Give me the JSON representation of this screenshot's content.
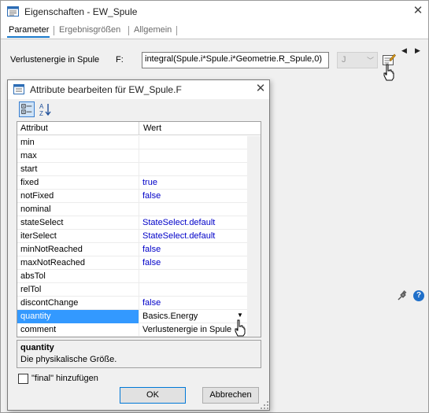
{
  "window": {
    "title": "Eigenschaften - EW_Spule",
    "tabs": [
      {
        "label": "Parameter",
        "active": true
      },
      {
        "label": "Ergebnisgrößen",
        "active": false
      },
      {
        "label": "Allgemein",
        "active": false
      }
    ],
    "param": {
      "label": "Verlustenergie in Spule",
      "name": "F:",
      "value": "integral(Spule.i*Spule.i*Geometrie.R_Spule,0)",
      "unit": "J"
    }
  },
  "dialog": {
    "title": "Attribute bearbeiten für EW_Spule.F",
    "columns": [
      "Attribut",
      "Wert"
    ],
    "rows": [
      {
        "name": "min",
        "value": ""
      },
      {
        "name": "max",
        "value": ""
      },
      {
        "name": "start",
        "value": ""
      },
      {
        "name": "fixed",
        "value": "true"
      },
      {
        "name": "notFixed",
        "value": "false"
      },
      {
        "name": "nominal",
        "value": ""
      },
      {
        "name": "stateSelect",
        "value": "StateSelect.default"
      },
      {
        "name": "iterSelect",
        "value": "StateSelect.default"
      },
      {
        "name": "minNotReached",
        "value": "false"
      },
      {
        "name": "maxNotReached",
        "value": "false"
      },
      {
        "name": "absTol",
        "value": ""
      },
      {
        "name": "relTol",
        "value": ""
      },
      {
        "name": "discontChange",
        "value": "false"
      },
      {
        "name": "quantity",
        "value": "Basics.Energy",
        "selected": true
      },
      {
        "name": "comment",
        "value": "Verlustenergie in Spule"
      }
    ],
    "description": {
      "title": "quantity",
      "text": "Die physikalische Größe."
    },
    "final_checkbox": {
      "label": "\"final\" hinzufügen",
      "checked": false
    },
    "ok_label": "OK",
    "cancel_label": "Abbrechen"
  },
  "colors": {
    "selection": "#3399ff",
    "value_blue": "#0000c8",
    "accent": "#1979ca"
  }
}
